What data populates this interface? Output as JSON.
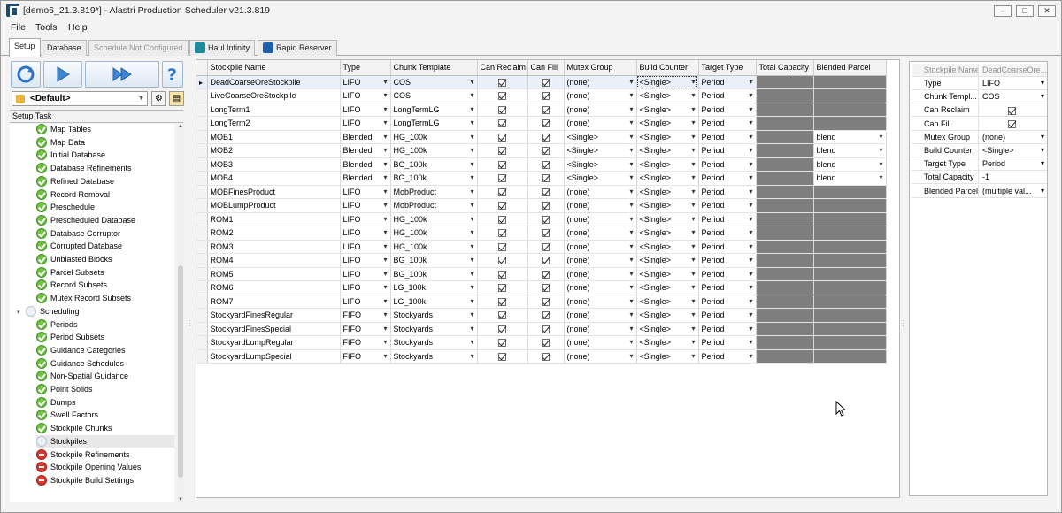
{
  "window": {
    "title": "[demo6_21.3.819*] - Alastri Production Scheduler v21.3.819",
    "icon": "app-logo-icon",
    "controls": {
      "minimize": "–",
      "maximize": "□",
      "close": "✕"
    }
  },
  "menu": [
    "File",
    "Tools",
    "Help"
  ],
  "tabs": [
    {
      "label": "Setup",
      "state": "active"
    },
    {
      "label": "Database",
      "state": "normal"
    },
    {
      "label": "Schedule Not Configured",
      "state": "disabled"
    },
    {
      "label": "Haul Infinity",
      "state": "normal",
      "icon": "haul-infinity-icon"
    },
    {
      "label": "Rapid Reserver",
      "state": "normal",
      "icon": "rapid-reserver-icon"
    }
  ],
  "toolbar": {
    "buttons": [
      "refresh-icon",
      "play-icon",
      "fast-forward-icon",
      "help-icon"
    ],
    "profile": "<Default>"
  },
  "setup_task": {
    "header": "Setup Task",
    "items": [
      {
        "label": "Map Tables",
        "status": "ok",
        "level": 1
      },
      {
        "label": "Map Data",
        "status": "ok",
        "level": 1
      },
      {
        "label": "Initial Database",
        "status": "ok",
        "level": 1
      },
      {
        "label": "Database Refinements",
        "status": "ok",
        "level": 1
      },
      {
        "label": "Refined Database",
        "status": "ok",
        "level": 1
      },
      {
        "label": "Record Removal",
        "status": "ok",
        "level": 1
      },
      {
        "label": "Preschedule",
        "status": "ok",
        "level": 1
      },
      {
        "label": "Prescheduled Database",
        "status": "ok",
        "level": 1
      },
      {
        "label": "Database Corruptor",
        "status": "ok",
        "level": 1
      },
      {
        "label": "Corrupted Database",
        "status": "ok",
        "level": 1
      },
      {
        "label": "Unblasted Blocks",
        "status": "ok",
        "level": 1
      },
      {
        "label": "Parcel Subsets",
        "status": "ok",
        "level": 1
      },
      {
        "label": "Record Subsets",
        "status": "ok",
        "level": 1
      },
      {
        "label": "Mutex Record Subsets",
        "status": "ok",
        "level": 1
      },
      {
        "label": "Scheduling",
        "status": "none",
        "level": 0
      },
      {
        "label": "Periods",
        "status": "ok",
        "level": 1
      },
      {
        "label": "Period Subsets",
        "status": "ok",
        "level": 1
      },
      {
        "label": "Guidance Categories",
        "status": "ok",
        "level": 1
      },
      {
        "label": "Guidance Schedules",
        "status": "ok",
        "level": 1
      },
      {
        "label": "Non-Spatial Guidance",
        "status": "ok",
        "level": 1
      },
      {
        "label": "Point Solids",
        "status": "ok",
        "level": 1
      },
      {
        "label": "Dumps",
        "status": "ok",
        "level": 1
      },
      {
        "label": "Swell Factors",
        "status": "ok",
        "level": 1
      },
      {
        "label": "Stockpile Chunks",
        "status": "ok",
        "level": 1
      },
      {
        "label": "Stockpiles",
        "status": "none",
        "level": 1,
        "selected": true
      },
      {
        "label": "Stockpile Refinements",
        "status": "err",
        "level": 1
      },
      {
        "label": "Stockpile Opening Values",
        "status": "err",
        "level": 1
      },
      {
        "label": "Stockpile Build Settings",
        "status": "err",
        "level": 1
      }
    ]
  },
  "stockpiles": {
    "columns": [
      "Stockpile Name",
      "Type",
      "Chunk Template",
      "Can Reclaim",
      "Can Fill",
      "Mutex Group",
      "Build Counter",
      "Target Type",
      "Total Capacity",
      "Blended Parcel"
    ],
    "rows": [
      {
        "name": "DeadCoarseOreStockpile",
        "type": "LIFO",
        "chunk": "COS",
        "reclaim": true,
        "fill": true,
        "mutex": "(none)",
        "build": "<Single>",
        "target": "Period",
        "blended": null
      },
      {
        "name": "LiveCoarseOreStockpile",
        "type": "LIFO",
        "chunk": "COS",
        "reclaim": true,
        "fill": true,
        "mutex": "(none)",
        "build": "<Single>",
        "target": "Period",
        "blended": null
      },
      {
        "name": "LongTerm1",
        "type": "LIFO",
        "chunk": "LongTermLG",
        "reclaim": true,
        "fill": true,
        "mutex": "(none)",
        "build": "<Single>",
        "target": "Period",
        "blended": null
      },
      {
        "name": "LongTerm2",
        "type": "LIFO",
        "chunk": "LongTermLG",
        "reclaim": true,
        "fill": true,
        "mutex": "(none)",
        "build": "<Single>",
        "target": "Period",
        "blended": null
      },
      {
        "name": "MOB1",
        "type": "Blended",
        "chunk": "HG_100k",
        "reclaim": true,
        "fill": true,
        "mutex": "<Single>",
        "build": "<Single>",
        "target": "Period",
        "blended": "blend"
      },
      {
        "name": "MOB2",
        "type": "Blended",
        "chunk": "HG_100k",
        "reclaim": true,
        "fill": true,
        "mutex": "<Single>",
        "build": "<Single>",
        "target": "Period",
        "blended": "blend"
      },
      {
        "name": "MOB3",
        "type": "Blended",
        "chunk": "BG_100k",
        "reclaim": true,
        "fill": true,
        "mutex": "<Single>",
        "build": "<Single>",
        "target": "Period",
        "blended": "blend"
      },
      {
        "name": "MOB4",
        "type": "Blended",
        "chunk": "BG_100k",
        "reclaim": true,
        "fill": true,
        "mutex": "<Single>",
        "build": "<Single>",
        "target": "Period",
        "blended": "blend"
      },
      {
        "name": "MOBFinesProduct",
        "type": "LIFO",
        "chunk": "MobProduct",
        "reclaim": true,
        "fill": true,
        "mutex": "(none)",
        "build": "<Single>",
        "target": "Period",
        "blended": null
      },
      {
        "name": "MOBLumpProduct",
        "type": "LIFO",
        "chunk": "MobProduct",
        "reclaim": true,
        "fill": true,
        "mutex": "(none)",
        "build": "<Single>",
        "target": "Period",
        "blended": null
      },
      {
        "name": "ROM1",
        "type": "LIFO",
        "chunk": "HG_100k",
        "reclaim": true,
        "fill": true,
        "mutex": "(none)",
        "build": "<Single>",
        "target": "Period",
        "blended": null
      },
      {
        "name": "ROM2",
        "type": "LIFO",
        "chunk": "HG_100k",
        "reclaim": true,
        "fill": true,
        "mutex": "(none)",
        "build": "<Single>",
        "target": "Period",
        "blended": null
      },
      {
        "name": "ROM3",
        "type": "LIFO",
        "chunk": "HG_100k",
        "reclaim": true,
        "fill": true,
        "mutex": "(none)",
        "build": "<Single>",
        "target": "Period",
        "blended": null
      },
      {
        "name": "ROM4",
        "type": "LIFO",
        "chunk": "BG_100k",
        "reclaim": true,
        "fill": true,
        "mutex": "(none)",
        "build": "<Single>",
        "target": "Period",
        "blended": null
      },
      {
        "name": "ROM5",
        "type": "LIFO",
        "chunk": "BG_100k",
        "reclaim": true,
        "fill": true,
        "mutex": "(none)",
        "build": "<Single>",
        "target": "Period",
        "blended": null
      },
      {
        "name": "ROM6",
        "type": "LIFO",
        "chunk": "LG_100k",
        "reclaim": true,
        "fill": true,
        "mutex": "(none)",
        "build": "<Single>",
        "target": "Period",
        "blended": null
      },
      {
        "name": "ROM7",
        "type": "LIFO",
        "chunk": "LG_100k",
        "reclaim": true,
        "fill": true,
        "mutex": "(none)",
        "build": "<Single>",
        "target": "Period",
        "blended": null
      },
      {
        "name": "StockyardFinesRegular",
        "type": "FIFO",
        "chunk": "Stockyards",
        "reclaim": true,
        "fill": true,
        "mutex": "(none)",
        "build": "<Single>",
        "target": "Period",
        "blended": null
      },
      {
        "name": "StockyardFinesSpecial",
        "type": "FIFO",
        "chunk": "Stockyards",
        "reclaim": true,
        "fill": true,
        "mutex": "(none)",
        "build": "<Single>",
        "target": "Period",
        "blended": null
      },
      {
        "name": "StockyardLumpRegular",
        "type": "FIFO",
        "chunk": "Stockyards",
        "reclaim": true,
        "fill": true,
        "mutex": "(none)",
        "build": "<Single>",
        "target": "Period",
        "blended": null
      },
      {
        "name": "StockyardLumpSpecial",
        "type": "FIFO",
        "chunk": "Stockyards",
        "reclaim": true,
        "fill": true,
        "mutex": "(none)",
        "build": "<Single>",
        "target": "Period",
        "blended": null
      }
    ]
  },
  "properties": {
    "header": {
      "label": "Stockpile Name",
      "value": "DeadCoarseOre..."
    },
    "rows": [
      {
        "label": "Type",
        "value": "LIFO",
        "kind": "dropdown"
      },
      {
        "label": "Chunk Templ...",
        "value": "COS",
        "kind": "dropdown"
      },
      {
        "label": "Can Reclaim",
        "value": "true",
        "kind": "check"
      },
      {
        "label": "Can Fill",
        "value": "true",
        "kind": "check"
      },
      {
        "label": "Mutex Group",
        "value": "(none)",
        "kind": "dropdown"
      },
      {
        "label": "Build Counter",
        "value": "<Single>",
        "kind": "dropdown"
      },
      {
        "label": "Target Type",
        "value": "Period",
        "kind": "dropdown"
      },
      {
        "label": "Total Capacity",
        "value": "-1",
        "kind": "text"
      },
      {
        "label": "Blended Parcel",
        "value": "(multiple val...",
        "kind": "dropdown"
      }
    ]
  },
  "colors": {
    "accent": "#3a7fc7",
    "disabled_cell": "#7f7f7f",
    "ok": "#6ec43e",
    "error": "#d8382f"
  }
}
